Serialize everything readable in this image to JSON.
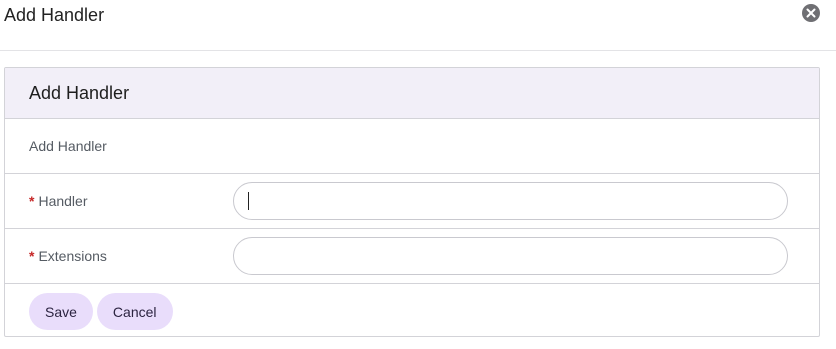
{
  "dialog": {
    "title": "Add Handler",
    "close_icon": "close-icon"
  },
  "panel": {
    "title": "Add Handler",
    "description": "Add Handler"
  },
  "form": {
    "required_marker": "*",
    "handler": {
      "label": "Handler",
      "value": "",
      "placeholder": ""
    },
    "extensions": {
      "label": "Extensions",
      "value": "",
      "placeholder": ""
    }
  },
  "actions": {
    "save_label": "Save",
    "cancel_label": "Cancel"
  },
  "colors": {
    "panel_header_bg": "#f2eff8",
    "button_bg": "#e9ddfb",
    "required": "#c62828"
  }
}
